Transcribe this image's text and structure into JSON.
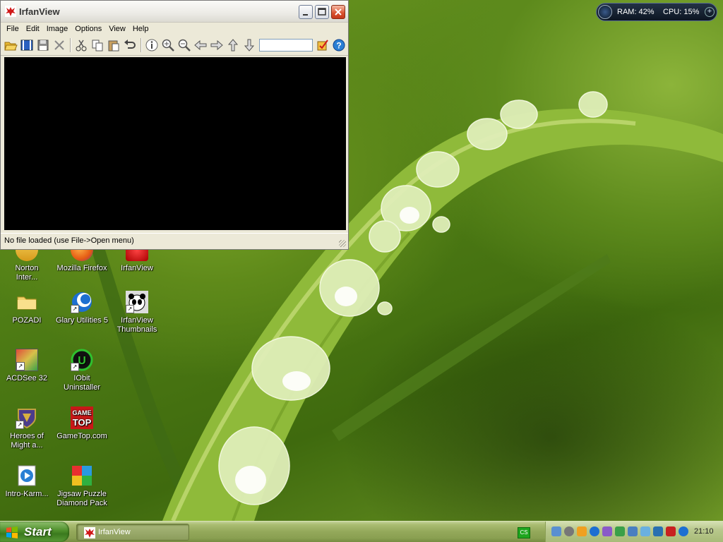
{
  "window": {
    "title": "IrfanView",
    "menu": [
      "File",
      "Edit",
      "Image",
      "Options",
      "View",
      "Help"
    ],
    "status": "No file loaded (use File->Open menu)",
    "toolbar_icons": [
      "open-folder-icon",
      "slideshow-icon",
      "save-icon",
      "delete-icon",
      "cut-icon",
      "copy-icon",
      "paste-icon",
      "undo-icon",
      "info-icon",
      "zoom-in-icon",
      "zoom-out-icon",
      "previous-icon",
      "next-icon",
      "first-file-icon",
      "last-file-icon",
      "options-icon",
      "help-icon"
    ],
    "title_buttons": [
      "minimize",
      "maximize",
      "close"
    ]
  },
  "desktop_icons": [
    {
      "name": "norton-internet-security",
      "label": "Norton\nInter..."
    },
    {
      "name": "mozilla-firefox",
      "label": "Mozilla Firefox"
    },
    {
      "name": "irfanview",
      "label": "IrfanView"
    },
    {
      "name": "pozadi",
      "label": "POZADI"
    },
    {
      "name": "glary-utilities",
      "label": "Glary Utilities 5"
    },
    {
      "name": "irfanview-thumbnails",
      "label": "IrfanView\nThumbnails"
    },
    {
      "name": "acdsee",
      "label": "ACDSee 32"
    },
    {
      "name": "iobit-uninstaller",
      "label": "IObit\nUninstaller"
    },
    {
      "name": "heroes-of-might",
      "label": "Heroes of\nMight a..."
    },
    {
      "name": "gametop",
      "label": "GameTop.com"
    },
    {
      "name": "intro-karm",
      "label": "Intro-Karm..."
    },
    {
      "name": "jigsaw-puzzle",
      "label": "Jigsaw Puzzle\nDiamond Pack"
    }
  ],
  "gadget": {
    "ram": "RAM: 42%",
    "cpu": "CPU: 15%"
  },
  "taskbar": {
    "start": "Start",
    "task": "IrfanView",
    "lang": "CS",
    "clock": "21:10"
  }
}
